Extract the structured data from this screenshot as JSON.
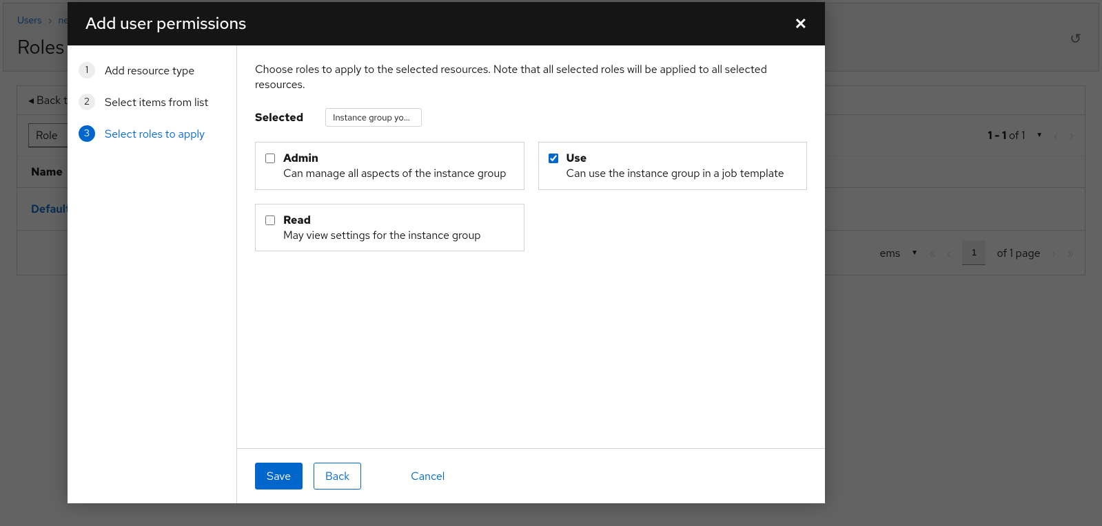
{
  "background": {
    "breadcrumb": {
      "root": "Users",
      "next": "ne"
    },
    "page_title": "Roles",
    "back_link": "Back t",
    "role_dropdown": "Role",
    "pager_summary_prefix": "1 - 1",
    "pager_summary_of": " of ",
    "pager_summary_total": "1",
    "table_header": "Name",
    "table_row_value": "Default",
    "footer_items_label": "ems",
    "footer_page_value": "1",
    "footer_of_page": "of 1 page"
  },
  "modal": {
    "title": "Add user permissions",
    "steps": [
      {
        "num": "1",
        "label": "Add resource type"
      },
      {
        "num": "2",
        "label": "Select items from list"
      },
      {
        "num": "3",
        "label": "Select roles to apply"
      }
    ],
    "instruction": "Choose roles to apply to the selected resources. Note that all selected roles will be applied to all selected resources.",
    "selected_label": "Selected",
    "selected_chip": "Instance group you ca...",
    "roles": [
      {
        "name": "Admin",
        "desc": "Can manage all aspects of the instance group",
        "checked": false
      },
      {
        "name": "Use",
        "desc": "Can use the instance group in a job template",
        "checked": true
      },
      {
        "name": "Read",
        "desc": "May view settings for the instance group",
        "checked": false
      }
    ],
    "buttons": {
      "save": "Save",
      "back": "Back",
      "cancel": "Cancel"
    }
  }
}
